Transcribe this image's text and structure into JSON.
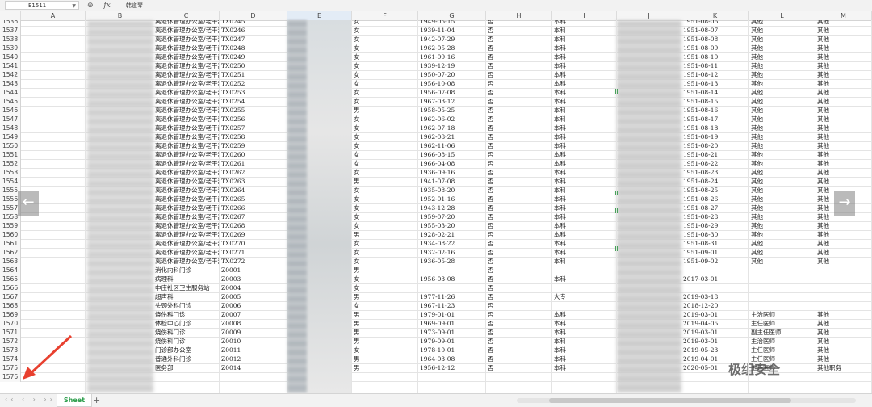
{
  "toolbar": {
    "cell_ref": "E1511",
    "zoom_icon": "zoom-icon",
    "fx_label": "fx",
    "formula_value": "韩道琴"
  },
  "columns": [
    "A",
    "B",
    "C",
    "D",
    "E",
    "F",
    "G",
    "H",
    "I",
    "J",
    "K",
    "L",
    "M"
  ],
  "selected_column": "E",
  "rows": [
    {
      "n": "1536",
      "c": "离退休管理办公室/老干部",
      "d": "TX0245",
      "f": "女",
      "g": "1949-05-15",
      "h": "否",
      "i": "本科",
      "k": "1951-08-06",
      "l": "其他",
      "m": "其他"
    },
    {
      "n": "1537",
      "c": "离退休管理办公室/老干部",
      "d": "TX0246",
      "f": "女",
      "g": "1939-11-04",
      "h": "否",
      "i": "本科",
      "k": "1951-08-07",
      "l": "其他",
      "m": "其他"
    },
    {
      "n": "1538",
      "c": "离退休管理办公室/老干部",
      "d": "TX0247",
      "f": "女",
      "g": "1942-07-29",
      "h": "否",
      "i": "本科",
      "k": "1951-08-08",
      "l": "其他",
      "m": "其他"
    },
    {
      "n": "1539",
      "c": "离退休管理办公室/老干部",
      "d": "TX0248",
      "f": "女",
      "g": "1962-05-28",
      "h": "否",
      "i": "本科",
      "k": "1951-08-09",
      "l": "其他",
      "m": "其他"
    },
    {
      "n": "1540",
      "c": "离退休管理办公室/老干部",
      "d": "TX0249",
      "f": "女",
      "g": "1961-09-16",
      "h": "否",
      "i": "本科",
      "k": "1951-08-10",
      "l": "其他",
      "m": "其他"
    },
    {
      "n": "1541",
      "c": "离退休管理办公室/老干部",
      "d": "TX0250",
      "f": "女",
      "g": "1939-12-19",
      "h": "否",
      "i": "本科",
      "k": "1951-08-11",
      "l": "其他",
      "m": "其他"
    },
    {
      "n": "1542",
      "c": "离退休管理办公室/老干部",
      "d": "TX0251",
      "f": "女",
      "g": "1950-07-20",
      "h": "否",
      "i": "本科",
      "k": "1951-08-12",
      "l": "其他",
      "m": "其他"
    },
    {
      "n": "1543",
      "c": "离退休管理办公室/老干部",
      "d": "TX0252",
      "f": "女",
      "g": "1956-10-08",
      "h": "否",
      "i": "本科",
      "k": "1951-08-13",
      "l": "其他",
      "m": "其他"
    },
    {
      "n": "1544",
      "c": "离退休管理办公室/老干部",
      "d": "TX0253",
      "f": "女",
      "g": "1956-07-08",
      "h": "否",
      "i": "本科",
      "k": "1951-08-14",
      "l": "其他",
      "m": "其他"
    },
    {
      "n": "1545",
      "c": "离退休管理办公室/老干部",
      "d": "TX0254",
      "f": "女",
      "g": "1967-03-12",
      "h": "否",
      "i": "本科",
      "k": "1951-08-15",
      "l": "其他",
      "m": "其他"
    },
    {
      "n": "1546",
      "c": "离退休管理办公室/老干部",
      "d": "TX0255",
      "f": "男",
      "g": "1958-05-25",
      "h": "否",
      "i": "本科",
      "k": "1951-08-16",
      "l": "其他",
      "m": "其他"
    },
    {
      "n": "1547",
      "c": "离退休管理办公室/老干部",
      "d": "TX0256",
      "f": "女",
      "g": "1962-06-02",
      "h": "否",
      "i": "本科",
      "k": "1951-08-17",
      "l": "其他",
      "m": "其他"
    },
    {
      "n": "1548",
      "c": "离退休管理办公室/老干部",
      "d": "TX0257",
      "f": "女",
      "g": "1962-07-18",
      "h": "否",
      "i": "本科",
      "k": "1951-08-18",
      "l": "其他",
      "m": "其他"
    },
    {
      "n": "1549",
      "c": "离退休管理办公室/老干部",
      "d": "TX0258",
      "f": "女",
      "g": "1962-08-21",
      "h": "否",
      "i": "本科",
      "k": "1951-08-19",
      "l": "其他",
      "m": "其他"
    },
    {
      "n": "1550",
      "c": "离退休管理办公室/老干部",
      "d": "TX0259",
      "f": "女",
      "g": "1962-11-06",
      "h": "否",
      "i": "本科",
      "k": "1951-08-20",
      "l": "其他",
      "m": "其他"
    },
    {
      "n": "1551",
      "c": "离退休管理办公室/老干部",
      "d": "TX0260",
      "f": "女",
      "g": "1966-08-15",
      "h": "否",
      "i": "本科",
      "k": "1951-08-21",
      "l": "其他",
      "m": "其他"
    },
    {
      "n": "1552",
      "c": "离退休管理办公室/老干部",
      "d": "TX0261",
      "f": "女",
      "g": "1966-04-08",
      "h": "否",
      "i": "本科",
      "k": "1951-08-22",
      "l": "其他",
      "m": "其他"
    },
    {
      "n": "1553",
      "c": "离退休管理办公室/老干部",
      "d": "TX0262",
      "f": "女",
      "g": "1936-09-16",
      "h": "否",
      "i": "本科",
      "k": "1951-08-23",
      "l": "其他",
      "m": "其他"
    },
    {
      "n": "1554",
      "c": "离退休管理办公室/老干部",
      "d": "TX0263",
      "f": "男",
      "g": "1941-07-08",
      "h": "否",
      "i": "本科",
      "k": "1951-08-24",
      "l": "其他",
      "m": "其他"
    },
    {
      "n": "1555",
      "c": "离退休管理办公室/老干部",
      "d": "TX0264",
      "f": "女",
      "g": "1935-08-20",
      "h": "否",
      "i": "本科",
      "k": "1951-08-25",
      "l": "其他",
      "m": "其他"
    },
    {
      "n": "1556",
      "c": "离退休管理办公室/老干部",
      "d": "TX0265",
      "f": "女",
      "g": "1952-01-16",
      "h": "否",
      "i": "本科",
      "k": "1951-08-26",
      "l": "其他",
      "m": "其他"
    },
    {
      "n": "1557",
      "c": "离退休管理办公室/老干部",
      "d": "TX0266",
      "f": "女",
      "g": "1943-12-28",
      "h": "否",
      "i": "本科",
      "k": "1951-08-27",
      "l": "其他",
      "m": "其他"
    },
    {
      "n": "1558",
      "c": "离退休管理办公室/老干部",
      "d": "TX0267",
      "f": "女",
      "g": "1959-07-20",
      "h": "否",
      "i": "本科",
      "k": "1951-08-28",
      "l": "其他",
      "m": "其他"
    },
    {
      "n": "1559",
      "c": "离退休管理办公室/老干部",
      "d": "TX0268",
      "f": "女",
      "g": "1955-03-20",
      "h": "否",
      "i": "本科",
      "k": "1951-08-29",
      "l": "其他",
      "m": "其他"
    },
    {
      "n": "1560",
      "c": "离退休管理办公室/老干部",
      "d": "TX0269",
      "f": "男",
      "g": "1928-02-21",
      "h": "否",
      "i": "本科",
      "k": "1951-08-30",
      "l": "其他",
      "m": "其他"
    },
    {
      "n": "1561",
      "c": "离退休管理办公室/老干部",
      "d": "TX0270",
      "f": "女",
      "g": "1934-08-22",
      "h": "否",
      "i": "本科",
      "k": "1951-08-31",
      "l": "其他",
      "m": "其他"
    },
    {
      "n": "1562",
      "c": "离退休管理办公室/老干部",
      "d": "TX0271",
      "f": "女",
      "g": "1932-02-16",
      "h": "否",
      "i": "本科",
      "k": "1951-09-01",
      "l": "其他",
      "m": "其他"
    },
    {
      "n": "1563",
      "c": "离退休管理办公室/老干部",
      "d": "TX0272",
      "f": "女",
      "g": "1936-05-28",
      "h": "否",
      "i": "本科",
      "k": "1951-09-02",
      "l": "其他",
      "m": "其他"
    },
    {
      "n": "1564",
      "c": "消化内科门诊",
      "d": "Z0001",
      "f": "男",
      "g": "",
      "h": "否",
      "i": "",
      "k": "",
      "l": "",
      "m": ""
    },
    {
      "n": "1565",
      "c": "病理科",
      "d": "Z0003",
      "f": "女",
      "g": "1956-03-08",
      "h": "否",
      "i": "本科",
      "k": "2017-03-01",
      "l": "",
      "m": ""
    },
    {
      "n": "1566",
      "c": "中庄社区卫生服务站",
      "d": "Z0004",
      "f": "女",
      "g": "",
      "h": "否",
      "i": "",
      "k": "",
      "l": "",
      "m": ""
    },
    {
      "n": "1567",
      "c": "超声科",
      "d": "Z0005",
      "f": "男",
      "g": "1977-11-26",
      "h": "否",
      "i": "大专",
      "k": "2019-03-18",
      "l": "",
      "m": ""
    },
    {
      "n": "1568",
      "c": "头颈外科门诊",
      "d": "Z0006",
      "f": "女",
      "g": "1967-11-23",
      "h": "否",
      "i": "",
      "k": "2018-12-20",
      "l": "",
      "m": ""
    },
    {
      "n": "1569",
      "c": "烧伤科门诊",
      "d": "Z0007",
      "f": "男",
      "g": "1979-01-01",
      "h": "否",
      "i": "本科",
      "k": "2019-03-01",
      "l": "主治医师",
      "m": "其他"
    },
    {
      "n": "1570",
      "c": "体检中心门诊",
      "d": "Z0008",
      "f": "男",
      "g": "1969-09-01",
      "h": "否",
      "i": "本科",
      "k": "2019-04-05",
      "l": "主任医师",
      "m": "其他"
    },
    {
      "n": "1571",
      "c": "烧伤科门诊",
      "d": "Z0009",
      "f": "男",
      "g": "1973-09-01",
      "h": "否",
      "i": "本科",
      "k": "2019-03-01",
      "l": "副主任医师",
      "m": "其他"
    },
    {
      "n": "1572",
      "c": "烧伤科门诊",
      "d": "Z0010",
      "f": "男",
      "g": "1979-09-01",
      "h": "否",
      "i": "本科",
      "k": "2019-03-01",
      "l": "主治医师",
      "m": "其他"
    },
    {
      "n": "1573",
      "c": "门诊部办公室",
      "d": "Z0011",
      "f": "女",
      "g": "1978-10-01",
      "h": "否",
      "i": "本科",
      "k": "2019-05-23",
      "l": "主任医师",
      "m": "其他"
    },
    {
      "n": "1574",
      "c": "普通外科门诊",
      "d": "Z0012",
      "f": "男",
      "g": "1964-03-08",
      "h": "否",
      "i": "本科",
      "k": "2019-04-01",
      "l": "主任医师",
      "m": "其他"
    },
    {
      "n": "1575",
      "c": "医务部",
      "d": "Z0014",
      "f": "男",
      "g": "1956-12-12",
      "h": "否",
      "i": "本科",
      "k": "2020-05-01",
      "l": "主任医师",
      "m": "其他职务"
    },
    {
      "n": "1576",
      "c": "",
      "d": "",
      "f": "",
      "g": "",
      "h": "",
      "i": "",
      "k": "",
      "l": "",
      "m": ""
    }
  ],
  "sheet_tab": "Sheet",
  "add_sheet": "+",
  "nav_prev": "←",
  "nav_next": "→",
  "watermark": "极组安全",
  "colors": {
    "sheet_tab_active": "#2a9d4a",
    "arrow": "#e8402f",
    "selected_col": "#e3ecf6"
  }
}
